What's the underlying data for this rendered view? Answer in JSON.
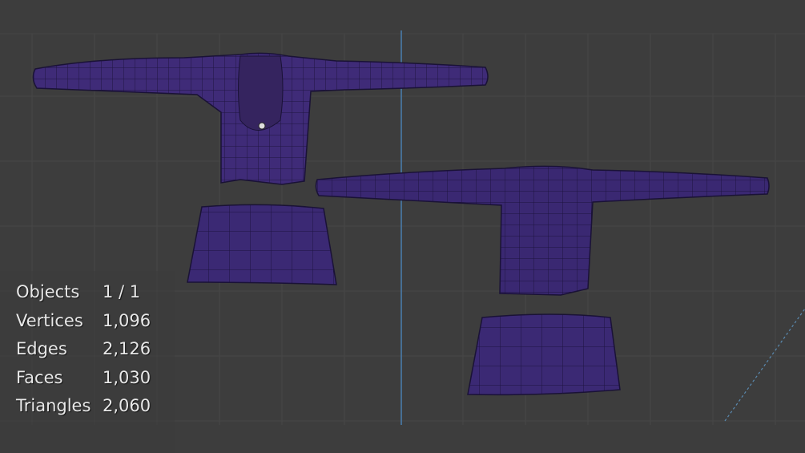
{
  "app": {
    "mode": "3D Viewport",
    "background": "#3d3d3d",
    "accent_axis_color": "#4a7fb0",
    "mesh_color": "#3f2b78"
  },
  "stats": {
    "rows": [
      {
        "label": "Objects",
        "value": "1 / 1"
      },
      {
        "label": "Vertices",
        "value": "1,096"
      },
      {
        "label": "Edges",
        "value": "2,126"
      },
      {
        "label": "Faces",
        "value": "1,030"
      },
      {
        "label": "Triangles",
        "value": "2,060"
      }
    ]
  }
}
